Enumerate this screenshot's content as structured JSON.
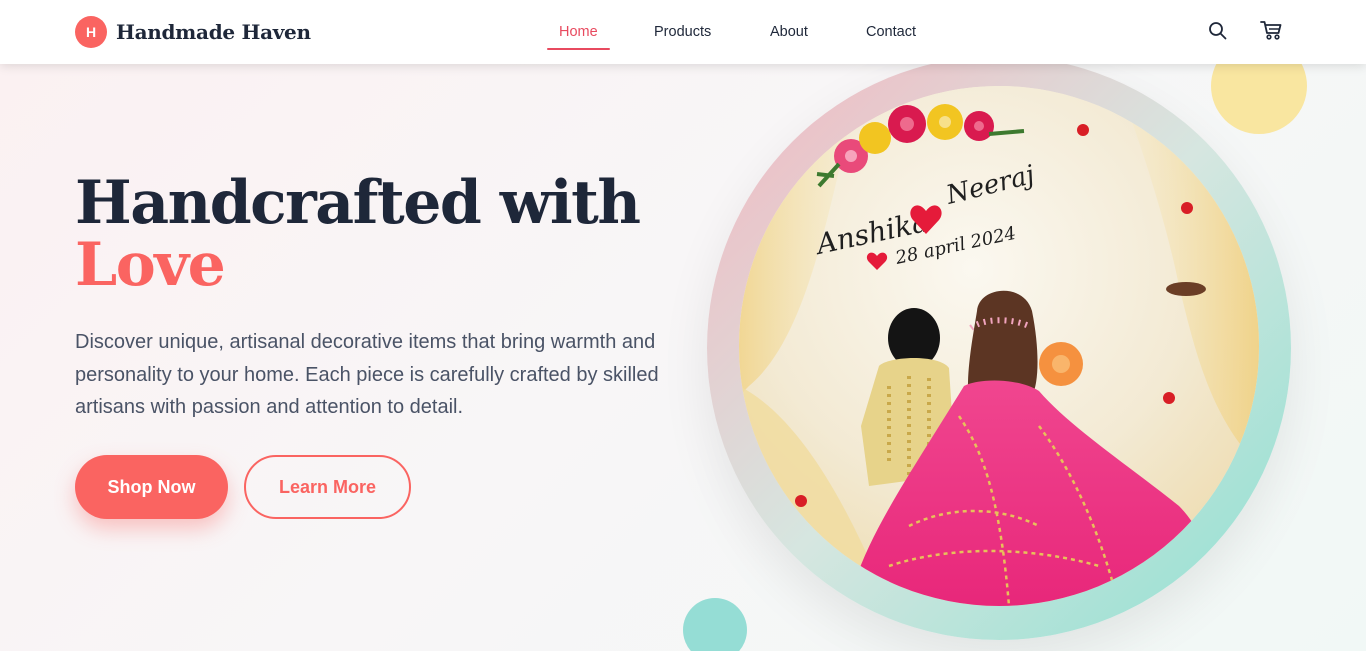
{
  "brand": {
    "initial": "H",
    "name": "Handmade Haven"
  },
  "nav": {
    "items": [
      {
        "label": "Home",
        "active": true
      },
      {
        "label": "Products",
        "active": false
      },
      {
        "label": "About",
        "active": false
      },
      {
        "label": "Contact",
        "active": false
      }
    ]
  },
  "header_icons": {
    "search": "search-icon",
    "cart": "cart-icon"
  },
  "hero": {
    "headline_line1": "Handcrafted with",
    "headline_accent": "Love",
    "description": "Discover unique, artisanal decorative items that bring warmth and personality to your home. Each piece is carefully crafted by skilled artisans with passion and attention to detail.",
    "primary_button": "Shop Now",
    "secondary_button": "Learn More"
  },
  "hero_image": {
    "names": "Anshika Neeraj",
    "name_left": "Anshika",
    "name_right": "Neeraj",
    "date": "28 april 2024"
  },
  "colors": {
    "accent": "#fa6461",
    "nav_active": "#e84a5f",
    "heading": "#1e2739",
    "body_text": "#4a5366",
    "deco_yellow": "#f9e6a0",
    "deco_teal": "#95ddd5"
  }
}
